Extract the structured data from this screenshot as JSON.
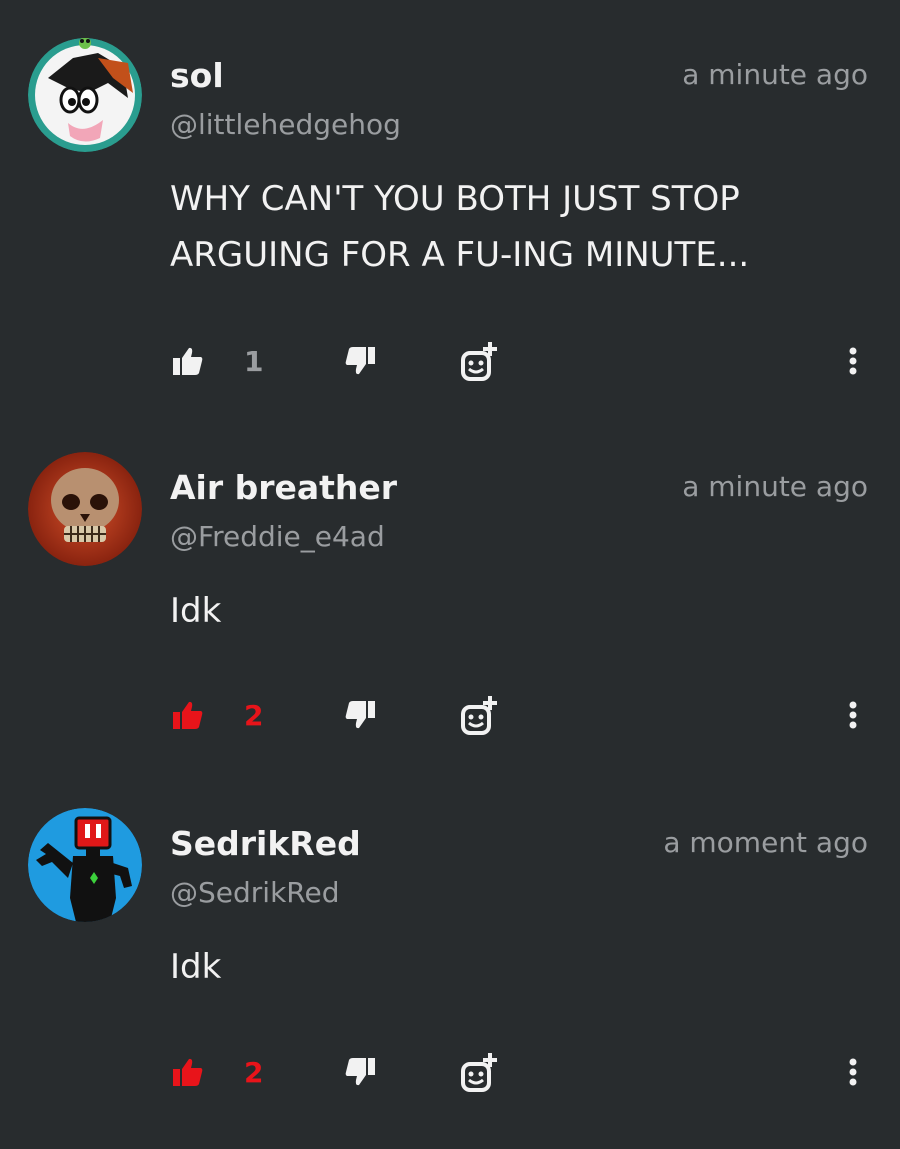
{
  "colors": {
    "background": "#282c2e",
    "text_primary": "#f2f2f2",
    "text_secondary": "#9a9da0",
    "like_active": "#e8141a"
  },
  "comments": [
    {
      "name": "sol",
      "handle": "@littlehedgehog",
      "time": "a minute ago",
      "text": "WHY CAN'T YOU BOTH JUST STOP ARGUING FOR A FU-ING MINUTE...",
      "likes": "1",
      "liked": false,
      "avatar": "cartoon-hedgehog-avatar"
    },
    {
      "name": "Air breather",
      "handle": "@Freddie_e4ad",
      "time": "a minute ago",
      "text": "Idk",
      "likes": "2",
      "liked": true,
      "avatar": "skull-avatar"
    },
    {
      "name": "SedrikRed",
      "handle": "@SedrikRed",
      "time": "a moment ago",
      "text": "Idk",
      "likes": "2",
      "liked": true,
      "avatar": "robot-silhouette-avatar"
    }
  ],
  "icons": {
    "like": "thumbs-up-icon",
    "dislike": "thumbs-down-icon",
    "react": "add-reaction-icon",
    "more": "more-vertical-icon"
  }
}
